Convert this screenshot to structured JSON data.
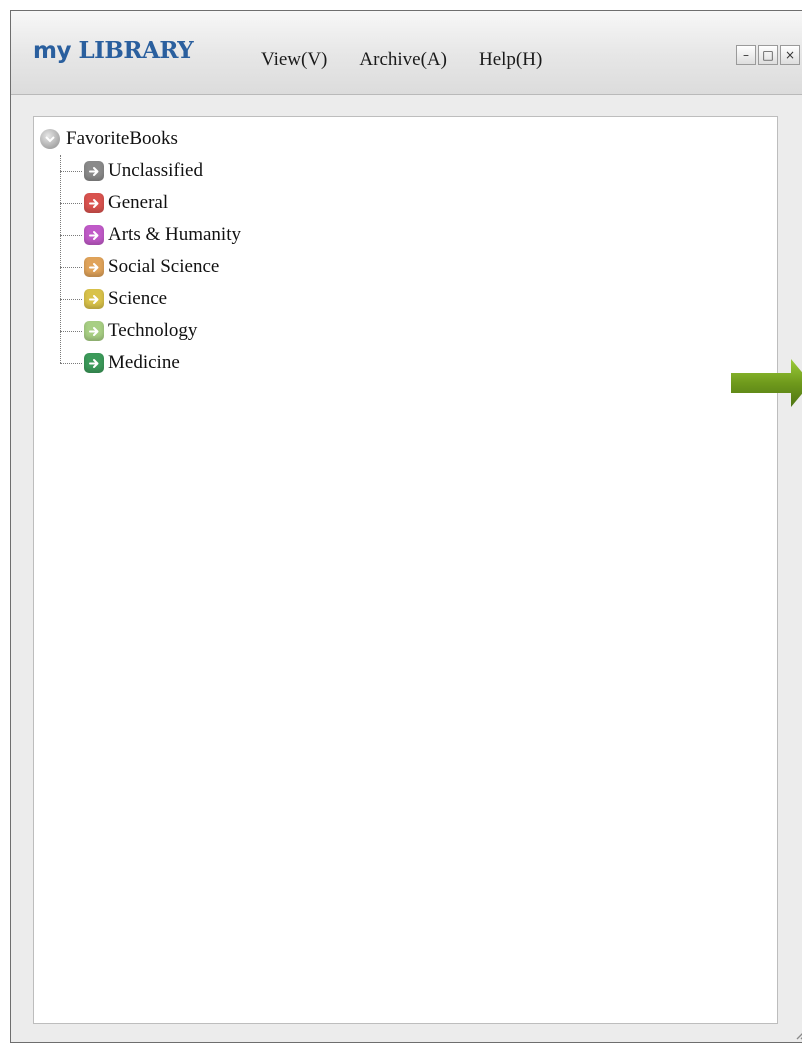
{
  "app": {
    "logo_prefix": "my",
    "logo_name": "LIBRARY"
  },
  "menu": [
    {
      "label": "View(V)"
    },
    {
      "label": "Archive(A)"
    },
    {
      "label": "Help(H)"
    }
  ],
  "window_controls": {
    "minimize": "–",
    "maximize": "□",
    "close": "×"
  },
  "tree": {
    "root": {
      "label": "FavoriteBooks",
      "icon": "chevron-down-icon"
    },
    "children": [
      {
        "label": "Unclassified",
        "icon": "arrow-right-icon",
        "color": "#8a8a8a"
      },
      {
        "label": "General",
        "icon": "arrow-right-icon",
        "color": "#d9534f"
      },
      {
        "label": "Arts & Humanity",
        "icon": "arrow-right-icon",
        "color": "#c05ac8"
      },
      {
        "label": "Social Science",
        "icon": "arrow-right-icon",
        "color": "#e0a35a"
      },
      {
        "label": "Science",
        "icon": "arrow-right-icon",
        "color": "#d9c24a"
      },
      {
        "label": "Technology",
        "icon": "arrow-right-icon",
        "color": "#a8cf84"
      },
      {
        "label": "Medicine",
        "icon": "arrow-right-icon",
        "color": "#3c9a5a"
      }
    ]
  },
  "colors": {
    "logo": "#2a5f9e",
    "arrow": "#6f9a1c"
  }
}
